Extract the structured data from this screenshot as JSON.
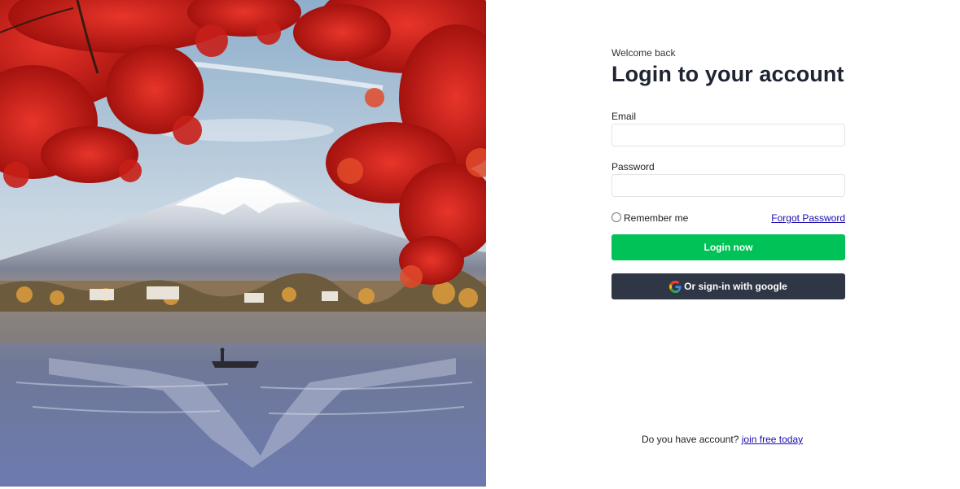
{
  "hero": {
    "image": "mount-fuji-autumn-lake-photo"
  },
  "form": {
    "eyebrow": "Welcome back",
    "title": "Login to your account",
    "email_label": "Email",
    "email_value": "",
    "password_label": "Password",
    "password_value": "",
    "remember_label": "Remember me",
    "forgot_label": "Forgot Password",
    "login_label": "Login now",
    "google_label": "Or sign-in with google"
  },
  "footer": {
    "prompt": "Do you have account?",
    "signup_link": "join free today"
  },
  "colors": {
    "login_button": "#00c257",
    "google_button": "#2f3746",
    "title": "#1e2431",
    "link": "#1a0dab"
  }
}
